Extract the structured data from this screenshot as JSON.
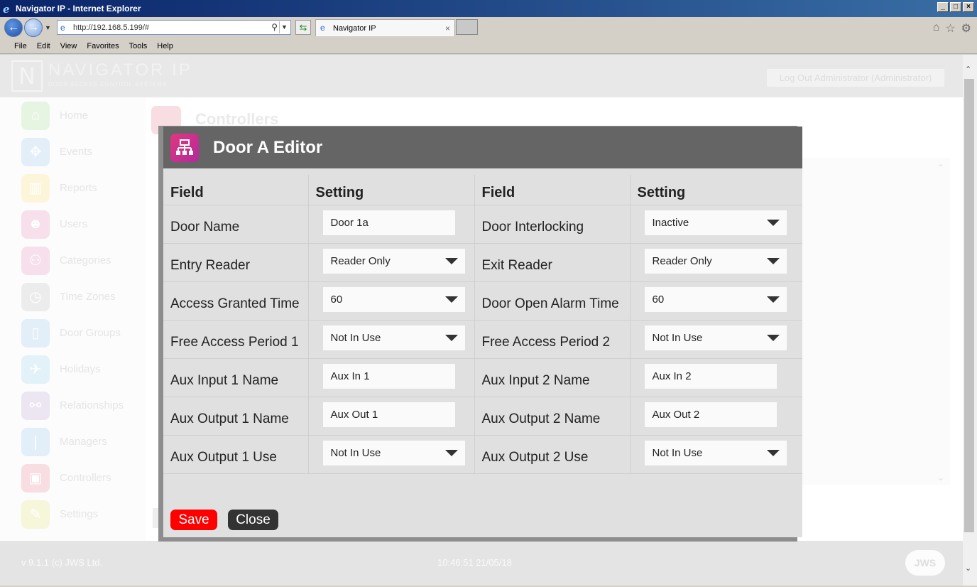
{
  "window": {
    "title": "Navigator IP - Internet Explorer",
    "address": "http://192.168.5.199/#",
    "tab_label": "Navigator IP",
    "menu": [
      "File",
      "Edit",
      "View",
      "Favorites",
      "Tools",
      "Help"
    ]
  },
  "header": {
    "brand_name": "NAVIGATOR IP",
    "brand_sub": "DOOR ACCESS CONTROL SYSTEMS",
    "user_link": "Log Out   Administrator (Administrator)"
  },
  "sidebar": {
    "items": [
      {
        "label": "Home",
        "icon": "home-icon",
        "color": "#e6f4e2"
      },
      {
        "label": "Events",
        "icon": "events-icon",
        "color": "#e2eef8"
      },
      {
        "label": "Reports",
        "icon": "reports-icon",
        "color": "#fdf5da"
      },
      {
        "label": "Users",
        "icon": "users-icon",
        "color": "#f7e0ec"
      },
      {
        "label": "Categories",
        "icon": "categories-icon",
        "color": "#f7e0ec"
      },
      {
        "label": "Time Zones",
        "icon": "clock-icon",
        "color": "#ececec"
      },
      {
        "label": "Door Groups",
        "icon": "door-icon",
        "color": "#e2eef8"
      },
      {
        "label": "Holidays",
        "icon": "plane-icon",
        "color": "#e2f2f8"
      },
      {
        "label": "Relationships",
        "icon": "link-icon",
        "color": "#ebe6f2"
      },
      {
        "label": "Managers",
        "icon": "manager-icon",
        "color": "#e2eef8"
      },
      {
        "label": "Controllers",
        "icon": "network-icon",
        "color": "#f8dde2"
      },
      {
        "label": "Settings",
        "icon": "wrench-icon",
        "color": "#f6f6da"
      }
    ]
  },
  "content": {
    "title": "Controllers"
  },
  "footer": {
    "version": "v 9.1.1 (c) JWS Ltd.",
    "clock": "10:46:51 21/05/18",
    "logo": "JWS"
  },
  "modal": {
    "title": "Door A Editor",
    "headers": [
      "Field",
      "Setting",
      "Field",
      "Setting"
    ],
    "rows": [
      {
        "l_label": "Door Name",
        "l_value": "Door 1a",
        "l_type": "input",
        "r_label": "Door Interlocking",
        "r_value": "Inactive",
        "r_type": "select"
      },
      {
        "l_label": "Entry Reader",
        "l_value": "Reader Only",
        "l_type": "select",
        "r_label": "Exit Reader",
        "r_value": "Reader Only",
        "r_type": "select"
      },
      {
        "l_label": "Access Granted Time",
        "l_value": "60",
        "l_type": "select",
        "r_label": "Door Open Alarm Time",
        "r_value": "60",
        "r_type": "select"
      },
      {
        "l_label": "Free Access Period 1",
        "l_value": "Not In Use",
        "l_type": "select",
        "r_label": "Free Access Period 2",
        "r_value": "Not In Use",
        "r_type": "select"
      },
      {
        "l_label": "Aux Input 1 Name",
        "l_value": "Aux In 1",
        "l_type": "input",
        "r_label": "Aux Input 2 Name",
        "r_value": "Aux In 2",
        "r_type": "input"
      },
      {
        "l_label": "Aux Output 1 Name",
        "l_value": "Aux Out 1",
        "l_type": "input",
        "r_label": "Aux Output 2 Name",
        "r_value": "Aux Out 2",
        "r_type": "input"
      },
      {
        "l_label": "Aux Output 1 Use",
        "l_value": "Not In Use",
        "l_type": "select",
        "r_label": "Aux Output 2 Use",
        "r_value": "Not In Use",
        "r_type": "select"
      }
    ],
    "save_label": "Save",
    "close_label": "Close"
  }
}
